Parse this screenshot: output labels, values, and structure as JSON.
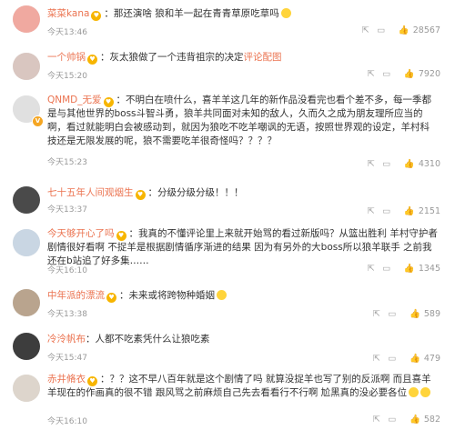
{
  "emoji_icons": [
    "laughing-emoji-icon",
    "thinking-emoji-icon",
    "crying-emoji-icon"
  ],
  "action_icons": {
    "share": "share-icon",
    "reply": "comment-icon",
    "like": "thumbs-up-icon"
  },
  "colors": {
    "username": "#eb7350",
    "text": "#333333",
    "time": "#999999",
    "badge": "#f7b500"
  },
  "comments": [
    {
      "username": "菜菜kana",
      "text": "那还演啥 狼和羊一起在青青草原吃草吗",
      "time": "今天13:46",
      "likes": "28567",
      "avatar_color": "#f0a9a0"
    },
    {
      "username": "一个帅锅",
      "text": "灰太狼做了一个违背祖宗的决定",
      "link": "评论配图",
      "time": "今天15:20",
      "likes": "7920",
      "avatar_color": "#d9c6c0"
    },
    {
      "username": "QNMD_无爱",
      "text": "不明白在喷什么，喜羊羊这几年的新作品没看完也看个差不多，每一季都是与其他世界的boss斗智斗勇，狼羊共同面对未知的敌人，久而久之成为朋友理所应当的啊，看过就能明白会被感动到，就因为狼吃不吃羊嘲讽的无语，按照世界观的设定，羊村科技还是无限发展的呢，狼不需要吃羊很奇怪吗？？？？",
      "time": "今天15:23",
      "likes": "4310",
      "avatar_color": "#e0e0e0"
    },
    {
      "username": "七十五年人间观烟生",
      "text": "分级分级分级！！！",
      "time": "今天13:37",
      "likes": "2151",
      "avatar_color": "#4a4a4a"
    },
    {
      "username": "今天够开心了吗",
      "text": "我真的不懂评论里上来就开始骂的看过新版吗？从篮出胜利 羊村守护者 剧情很好看啊 不捉羊是根据剧情循序渐进的结果 因为有另外的大boss所以狼羊联手 之前我还在b站追了好多集……",
      "time": "今天16:10",
      "likes": "1345",
      "avatar_color": "#c9d6e3"
    },
    {
      "username": "中年派的漂流",
      "text": "未来或将跨物种婚姻",
      "time": "今天13:38",
      "likes": "589",
      "avatar_color": "#b9a48e"
    },
    {
      "username": "冷泠帆布",
      "text": "人都不吃素凭什么让狼吃素",
      "time": "今天15:47",
      "likes": "479",
      "avatar_color": "#3d3d3d"
    },
    {
      "username": "赤井脩衣",
      "text": "？？这不早八百年就是这个剧情了吗 就算没捉羊也写了别的反派啊 而且喜羊羊现在的作画真的很不错 跟风骂之前麻烦自己先去看看行不行啊 尬黑真的没必要各位",
      "time": "今天16:10",
      "likes": "582",
      "avatar_color": "#ddd5cc"
    }
  ]
}
